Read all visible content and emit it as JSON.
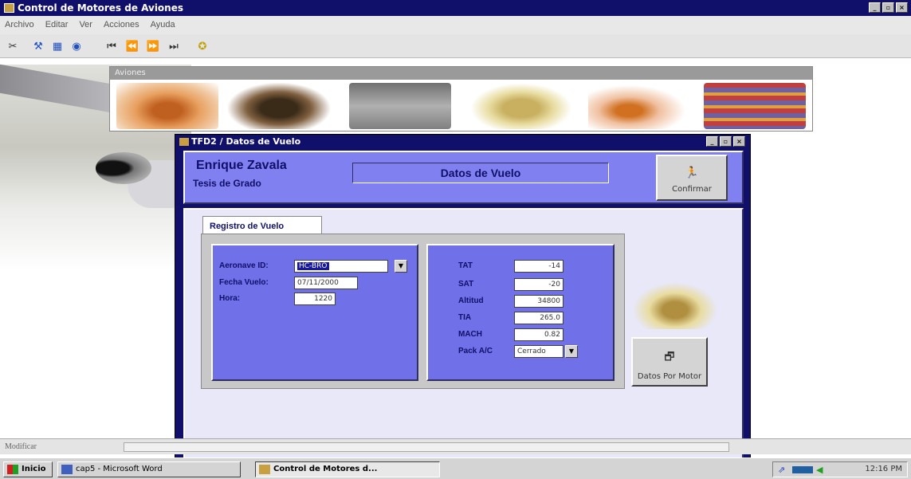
{
  "window": {
    "title": "Control de Motores de Aviones",
    "buttons": [
      "_",
      "▫",
      "×"
    ]
  },
  "menu": [
    "Archivo",
    "Editar",
    "Ver",
    "Acciones",
    "Ayuda"
  ],
  "toolbar": {
    "icons": [
      "cut-icon",
      "tool-icon",
      "grid-icon",
      "binoculars-icon",
      "first-record-icon",
      "prev-record-icon",
      "next-record-icon",
      "last-record-icon",
      "help-icon"
    ]
  },
  "aviones": {
    "title": "Aviones"
  },
  "child": {
    "title": "TFD2 / Datos de Vuelo",
    "header": {
      "name": "Enrique Zavala",
      "subtitle": "Tesis de Grado",
      "form_title": "Datos de Vuelo",
      "confirm_label": "Confirmar"
    },
    "tab": "Registro de Vuelo",
    "left": {
      "aeronave_label": "Aeronave ID:",
      "aeronave_value": "HC-BRO",
      "fecha_label": "Fecha Vuelo:",
      "fecha_value": "07/11/2000",
      "hora_label": "Hora:",
      "hora_value": "1220"
    },
    "right": {
      "tat_label": "TAT",
      "tat_value": "-14",
      "sat_label": "SAT",
      "sat_value": "-20",
      "alt_label": "Altitud",
      "alt_value": "34800",
      "tia_label": "TIA",
      "tia_value": "265.0",
      "mach_label": "MACH",
      "mach_value": "0.82",
      "pack_label": "Pack A/C",
      "pack_value": "Cerrado"
    },
    "datos_motor_label": "Datos Por Motor"
  },
  "status": {
    "text": "Modificar"
  },
  "taskbar": {
    "start": "Inicio",
    "items": [
      "cap5 - Microsoft Word",
      "Control de Motores d..."
    ],
    "clock": "12:16 PM"
  }
}
